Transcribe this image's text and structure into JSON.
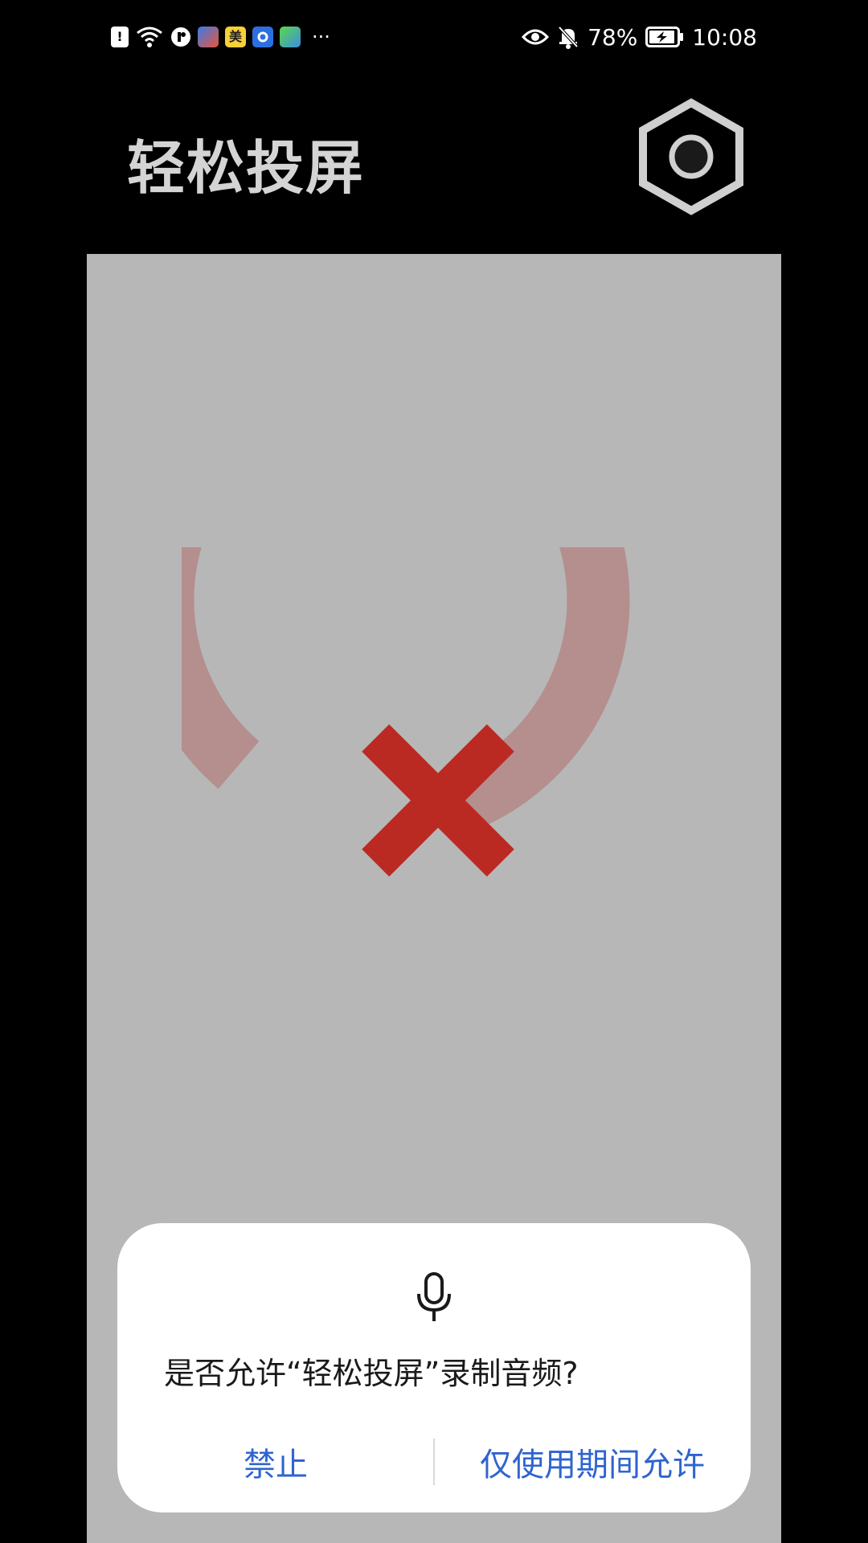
{
  "status_bar": {
    "left_icons": [
      "alert-icon",
      "wifi-icon",
      "app-notification-icon",
      "app-icon",
      "meituan-app-icon",
      "app-icon",
      "iqiyi-app-icon"
    ],
    "meituan_label": "美",
    "more_label": "···",
    "battery_percent": "78%",
    "time": "10:08"
  },
  "header": {
    "title": "轻松投屏"
  },
  "dialog": {
    "question": "是否允许“轻松投屏”录制音频?",
    "deny_label": "禁止",
    "allow_label": "仅使用期间允许"
  },
  "colors": {
    "preview_bg": "#b7b7b7",
    "ring": "#b58e8e",
    "cross": "#bb2a22",
    "accent": "#2f64d0"
  }
}
